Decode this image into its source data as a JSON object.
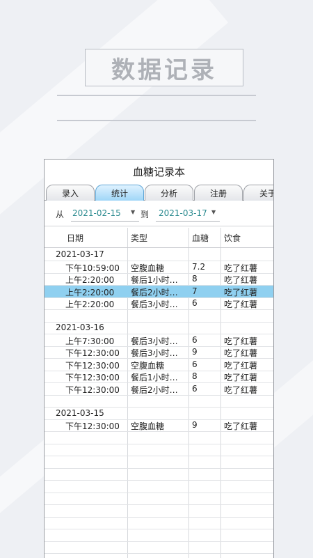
{
  "banner": {
    "title": "数据记录"
  },
  "app": {
    "title": "血糖记录本",
    "tabs": [
      "录入",
      "统计",
      "分析",
      "注册",
      "关于"
    ],
    "active_tab": "统计"
  },
  "filter": {
    "from_label": "从",
    "from_date": "2021-02-15",
    "to_label": "到",
    "to_date": "2021-03-17"
  },
  "table": {
    "headers": [
      "日期",
      "类型",
      "血糖",
      "饮食"
    ],
    "groups": [
      {
        "date": "2021-03-17",
        "rows": [
          {
            "time": "下午10:59:00",
            "type": "空腹血糖",
            "value": "7.2",
            "food": "吃了红薯"
          },
          {
            "time": "上午2:20:00",
            "type": "餐后1小时…",
            "value": "8",
            "food": "吃了红薯"
          },
          {
            "time": "上午2:20:00",
            "type": "餐后2小时…",
            "value": "7",
            "food": "吃了红薯",
            "selected": true
          },
          {
            "time": "上午2:20:00",
            "type": "餐后3小时…",
            "value": "6",
            "food": "吃了红薯"
          }
        ]
      },
      {
        "date": "2021-03-16",
        "rows": [
          {
            "time": "上午7:30:00",
            "type": "餐后3小时…",
            "value": "6",
            "food": "吃了红薯"
          },
          {
            "time": "下午12:30:00",
            "type": "餐后3小时…",
            "value": "9",
            "food": "吃了红薯"
          },
          {
            "time": "下午12:30:00",
            "type": "空腹血糖",
            "value": "6",
            "food": "吃了红薯"
          },
          {
            "time": "下午12:30:00",
            "type": "餐后1小时…",
            "value": "8",
            "food": "吃了红薯"
          },
          {
            "time": "下午12:30:00",
            "type": "餐后2小时…",
            "value": "6",
            "food": "吃了红薯"
          }
        ]
      },
      {
        "date": "2021-03-15",
        "rows": [
          {
            "time": "下午12:30:00",
            "type": "空腹血糖",
            "value": "9",
            "food": "吃了红薯"
          }
        ]
      }
    ]
  },
  "colors": {
    "accent": "#8fd0f0",
    "date_text": "#2a8a8f"
  }
}
